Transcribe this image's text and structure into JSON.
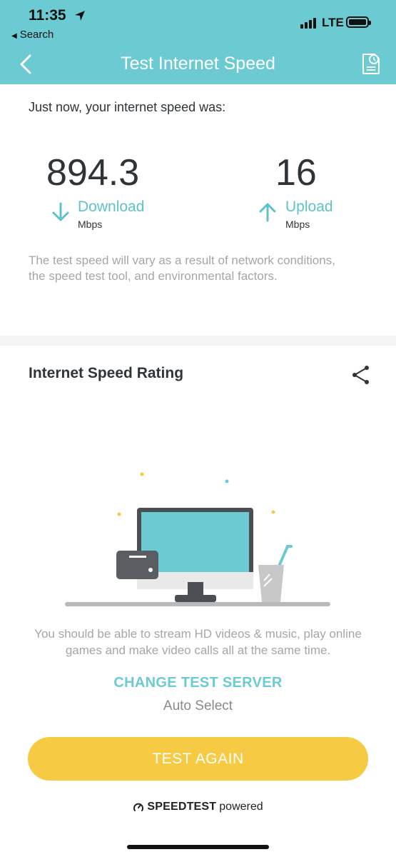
{
  "status_bar": {
    "time": "11:35",
    "back_app": "Search",
    "network": "LTE"
  },
  "header": {
    "title": "Test Internet Speed"
  },
  "result": {
    "intro": "Just now, your internet speed was:",
    "download": {
      "value": "894.3",
      "label": "Download",
      "unit": "Mbps"
    },
    "upload": {
      "value": "16",
      "label": "Upload",
      "unit": "Mbps"
    },
    "note": "The test speed will vary as a result of network conditions, the speed test tool, and environmental factors."
  },
  "rating": {
    "title": "Internet Speed Rating",
    "description": "You should be able to stream HD videos & music, play online games and make video calls all at the same time."
  },
  "server": {
    "change_label": "CHANGE TEST SERVER",
    "selected": "Auto Select"
  },
  "actions": {
    "test_again": "TEST AGAIN"
  },
  "footer": {
    "brand": "SPEEDTEST",
    "suffix": "powered"
  },
  "colors": {
    "header_bg": "#6ccad2",
    "accent": "#5fc2cb",
    "button": "#f6ca43",
    "muted_text": "#a6a6a6"
  }
}
